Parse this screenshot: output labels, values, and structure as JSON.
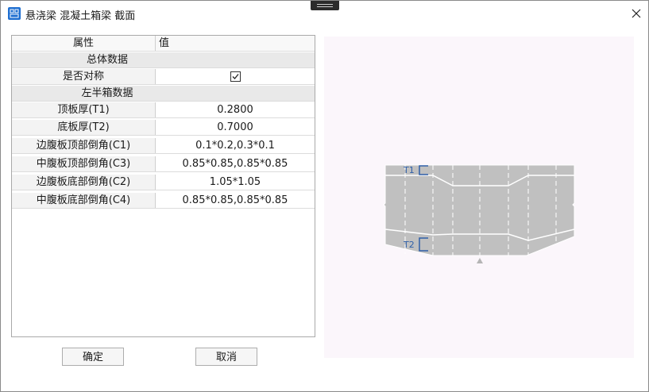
{
  "window": {
    "title": "悬浇梁 混凝土箱梁 截面"
  },
  "grid": {
    "header": {
      "property": "属性",
      "value": "值"
    },
    "sections": [
      {
        "group": "总体数据",
        "rows": [
          {
            "label": "是否对称",
            "type": "checkbox",
            "checked": true
          }
        ]
      },
      {
        "group": "左半箱数据",
        "rows": [
          {
            "label": "顶板厚(T1)",
            "value": "0.2800"
          },
          {
            "label": "底板厚(T2)",
            "value": "0.7000"
          },
          {
            "label": "边腹板顶部倒角(C1)",
            "value": "0.1*0.2,0.3*0.1"
          },
          {
            "label": "中腹板顶部倒角(C3)",
            "value": "0.85*0.85,0.85*0.85"
          },
          {
            "label": "边腹板底部倒角(C2)",
            "value": "1.05*1.05"
          },
          {
            "label": "中腹板底部倒角(C4)",
            "value": "0.85*0.85,0.85*0.85"
          }
        ]
      }
    ]
  },
  "buttons": {
    "ok": "确定",
    "cancel": "取消"
  },
  "preview": {
    "t1_label": "T1",
    "t2_label": "T2",
    "fill_color": "#c0c0c0",
    "dim_color": "#2f5fa8"
  }
}
